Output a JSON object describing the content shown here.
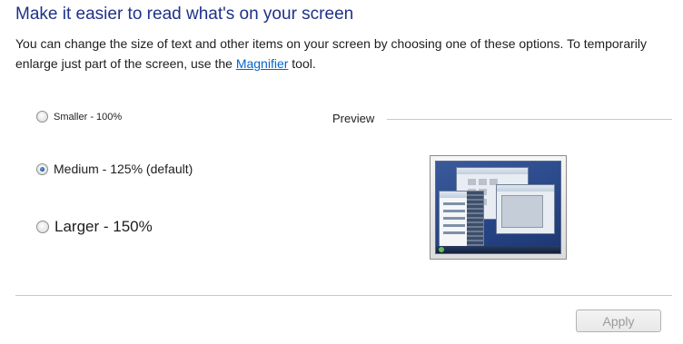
{
  "title": "Make it easier to read what's on your screen",
  "description": {
    "before_link": "You can change the size of text and other items on your screen by choosing one of these options. To temporarily enlarge just part of the screen, use the ",
    "link": "Magnifier",
    "after_link": " tool."
  },
  "options": [
    {
      "label": "Smaller - 100%",
      "selected": false
    },
    {
      "label": "Medium - 125% (default)",
      "selected": true
    },
    {
      "label": "Larger - 150%",
      "selected": false
    }
  ],
  "preview": {
    "label": "Preview",
    "icon": "desktop-preview-icon"
  },
  "apply_button": {
    "label": "Apply",
    "enabled": false
  },
  "colors": {
    "title": "#1e3287",
    "link": "#0066cc",
    "disabled_text": "#9a9a9a"
  }
}
